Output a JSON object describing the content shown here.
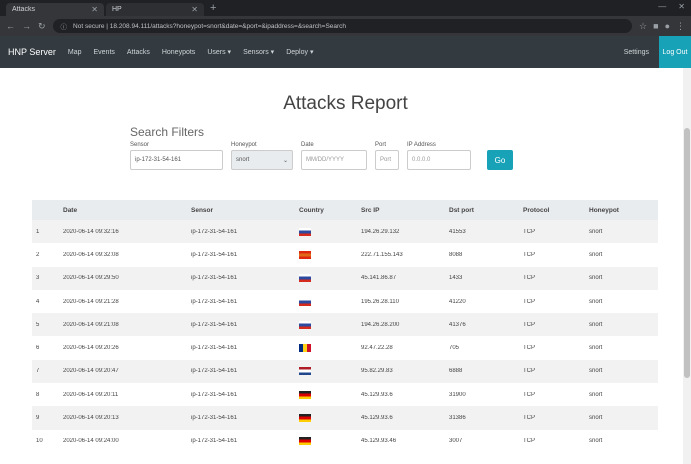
{
  "browser": {
    "tabs": [
      {
        "label": "Attacks"
      },
      {
        "label": "HP"
      }
    ],
    "url": "Not secure | 18.208.94.111/attacks?honeypot=snort&date=&port=&ipaddress=&search=Search",
    "url_secure_label": "Not secure"
  },
  "nav": {
    "brand": "HNP Server",
    "items": [
      "Map",
      "Events",
      "Attacks",
      "Honeypots",
      "Users ▾",
      "Sensors ▾",
      "Deploy ▾"
    ],
    "settings": "Settings",
    "logout": "Log Out"
  },
  "page": {
    "title": "Attacks Report"
  },
  "filters": {
    "title": "Search Filters",
    "sensor_label": "Sensor",
    "sensor_value": "ip-172-31-54-161",
    "honeypot_label": "Honeypot",
    "honeypot_value": "snort",
    "date_label": "Date",
    "date_placeholder": "MM/DD/YYYY",
    "port_label": "Port",
    "port_placeholder": "Port",
    "ip_label": "IP Address",
    "ip_placeholder": "0.0.0.0",
    "search_label": "Go"
  },
  "table": {
    "headers": [
      "",
      "Date",
      "Sensor",
      "Country",
      "Src IP",
      "Dst port",
      "Protocol",
      "Honeypot"
    ],
    "rows": [
      {
        "n": "1",
        "date": "2020-06-14 09:32:16",
        "sensor": "ip-172-31-54-161",
        "flag": "ru",
        "ip": "194.26.29.132",
        "port": "41553",
        "proto": "TCP",
        "hp": "snort"
      },
      {
        "n": "2",
        "date": "2020-06-14 09:32:08",
        "sensor": "ip-172-31-54-161",
        "flag": "cn",
        "ip": "222.71.155.143",
        "port": "8088",
        "proto": "TCP",
        "hp": "snort"
      },
      {
        "n": "3",
        "date": "2020-06-14 09:29:50",
        "sensor": "ip-172-31-54-161",
        "flag": "ru",
        "ip": "45.141.86.87",
        "port": "1433",
        "proto": "TCP",
        "hp": "snort"
      },
      {
        "n": "4",
        "date": "2020-06-14 09:21:28",
        "sensor": "ip-172-31-54-161",
        "flag": "ru",
        "ip": "195.26.28.110",
        "port": "41220",
        "proto": "TCP",
        "hp": "snort"
      },
      {
        "n": "5",
        "date": "2020-06-14 09:21:08",
        "sensor": "ip-172-31-54-161",
        "flag": "ru",
        "ip": "194.26.28.200",
        "port": "41376",
        "proto": "TCP",
        "hp": "snort"
      },
      {
        "n": "6",
        "date": "2020-06-14 09:20:26",
        "sensor": "ip-172-31-54-161",
        "flag": "ro",
        "ip": "92.47.22.28",
        "port": "705",
        "proto": "TCP",
        "hp": "snort"
      },
      {
        "n": "7",
        "date": "2020-06-14 09:20:47",
        "sensor": "ip-172-31-54-161",
        "flag": "nl",
        "ip": "95.82.29.83",
        "port": "6888",
        "proto": "TCP",
        "hp": "snort"
      },
      {
        "n": "8",
        "date": "2020-06-14 09:20:11",
        "sensor": "ip-172-31-54-161",
        "flag": "de",
        "ip": "45.129.93.6",
        "port": "31900",
        "proto": "TCP",
        "hp": "snort"
      },
      {
        "n": "9",
        "date": "2020-06-14 09:20:13",
        "sensor": "ip-172-31-54-161",
        "flag": "de",
        "ip": "45.129.93.6",
        "port": "31386",
        "proto": "TCP",
        "hp": "snort"
      },
      {
        "n": "10",
        "date": "2020-06-14 09:24:00",
        "sensor": "ip-172-31-54-161",
        "flag": "de",
        "ip": "45.129.93.46",
        "port": "3007",
        "proto": "TCP",
        "hp": "snort"
      }
    ]
  },
  "flag_colors": {
    "ru": [
      "#ffffff",
      "#2b4aa0",
      "#d52b1e"
    ],
    "cn": [
      "#de2910",
      "#e06a1a",
      "#de2910"
    ],
    "ro": [
      "#002b7f",
      "#fcd116",
      "#ce1126"
    ],
    "nl": [
      "#ae1c28",
      "#ffffff",
      "#21468b"
    ],
    "de": [
      "#222222",
      "#dd0000",
      "#ffce00"
    ]
  }
}
